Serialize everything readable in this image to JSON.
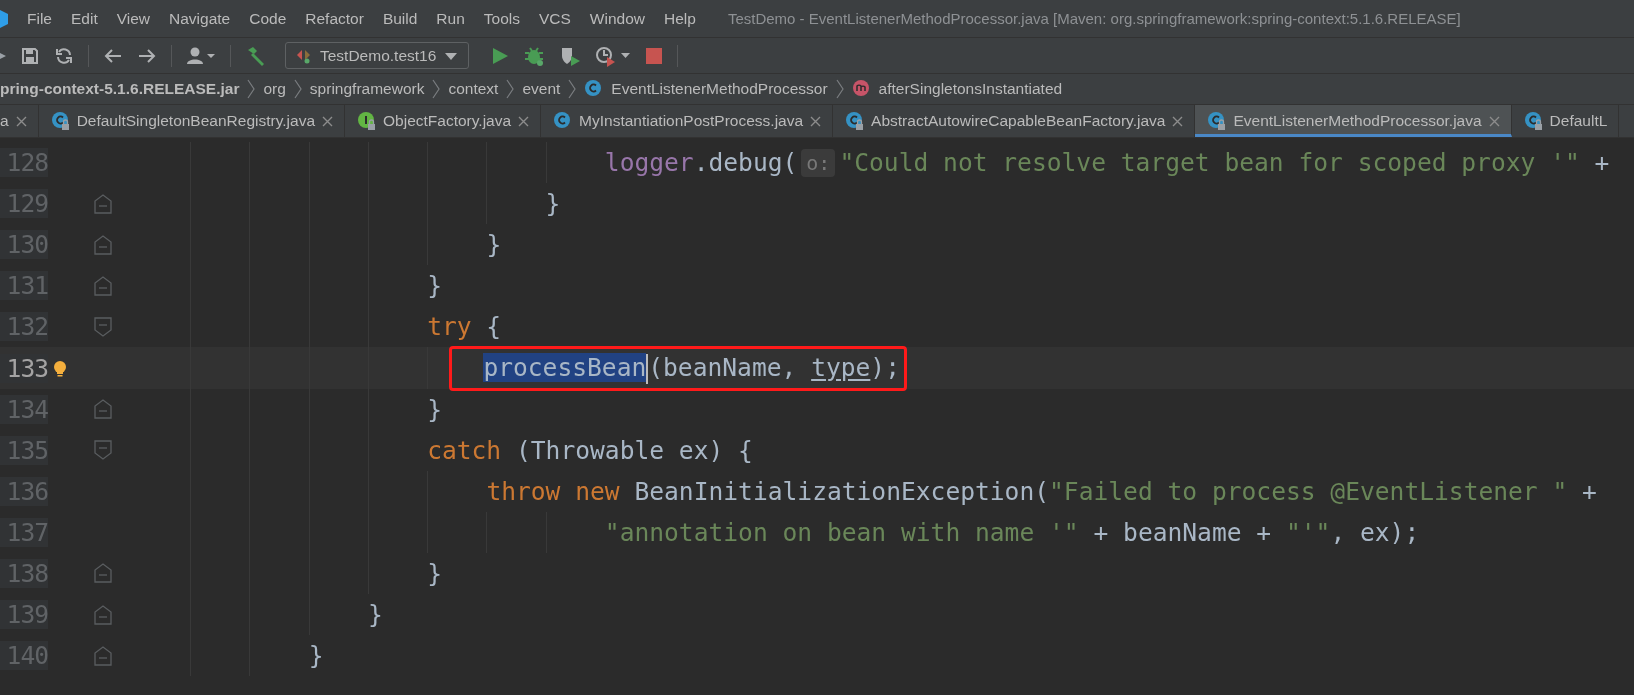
{
  "menu": [
    {
      "label": "File"
    },
    {
      "label": "Edit"
    },
    {
      "label": "View"
    },
    {
      "label": "Navigate"
    },
    {
      "label": "Code"
    },
    {
      "label": "Refactor"
    },
    {
      "label": "Build"
    },
    {
      "label": "Run"
    },
    {
      "label": "Tools"
    },
    {
      "label": "VCS"
    },
    {
      "label": "Window"
    },
    {
      "label": "Help"
    }
  ],
  "window": {
    "title": "TestDemo - EventListenerMethodProcessor.java [Maven: org.springframework:spring-context:5.1.6.RELEASE]"
  },
  "toolbar": {
    "run_configuration": "TestDemo.test16"
  },
  "breadcrumbs": [
    {
      "label": "pring-context-5.1.6.RELEASE.jar",
      "kind": "jar"
    },
    {
      "label": "org",
      "kind": "package"
    },
    {
      "label": "springframework",
      "kind": "package"
    },
    {
      "label": "context",
      "kind": "package"
    },
    {
      "label": "event",
      "kind": "package"
    },
    {
      "label": "EventListenerMethodProcessor",
      "kind": "class"
    },
    {
      "label": "afterSingletonsInstantiated",
      "kind": "method"
    }
  ],
  "tabs": [
    {
      "label": "a",
      "locked": false,
      "closable": true,
      "selected": false
    },
    {
      "label": "DefaultSingletonBeanRegistry.java",
      "kind": "class",
      "locked": true,
      "closable": true,
      "selected": false
    },
    {
      "label": "ObjectFactory.java",
      "kind": "interface",
      "locked": true,
      "closable": true,
      "selected": false
    },
    {
      "label": "MyInstantiationPostProcess.java",
      "kind": "class",
      "locked": false,
      "closable": true,
      "selected": false
    },
    {
      "label": "AbstractAutowireCapableBeanFactory.java",
      "kind": "class",
      "locked": true,
      "closable": true,
      "selected": false
    },
    {
      "label": "EventListenerMethodProcessor.java",
      "kind": "class",
      "locked": true,
      "closable": true,
      "selected": true
    },
    {
      "label": "DefaultL",
      "kind": "class",
      "locked": true,
      "closable": false,
      "selected": false
    }
  ],
  "editor": {
    "lines": [
      {
        "number": "128",
        "current": false,
        "bulb": false,
        "framed": false,
        "segments": [
          {
            "kind": "field",
            "text": "                                logger"
          },
          {
            "kind": "plain",
            "text": ".debug("
          },
          {
            "kind": "hint",
            "text": "o:"
          },
          {
            "kind": "string",
            "text": "\"Could not resolve target bean for scoped proxy '\""
          },
          {
            "kind": "plain",
            "text": " +"
          }
        ]
      },
      {
        "number": "129",
        "kind": "fold-end",
        "current": false,
        "bulb": false,
        "framed": false,
        "segments": [
          {
            "kind": "plain",
            "text": "                            }"
          }
        ]
      },
      {
        "number": "130",
        "kind": "fold-end",
        "current": false,
        "bulb": false,
        "framed": false,
        "segments": [
          {
            "kind": "plain",
            "text": "                        }"
          }
        ]
      },
      {
        "number": "131",
        "kind": "fold-end",
        "current": false,
        "bulb": false,
        "framed": false,
        "segments": [
          {
            "kind": "plain",
            "text": "                    }"
          }
        ]
      },
      {
        "number": "132",
        "kind": "fold-start",
        "current": false,
        "bulb": false,
        "framed": false,
        "segments": [
          {
            "kind": "keyword",
            "text": "                    try"
          },
          {
            "kind": "plain",
            "text": " {"
          }
        ]
      },
      {
        "number": "133",
        "current": true,
        "bulb": true,
        "framed": true,
        "segments": [
          {
            "kind": "selected",
            "text": "                        processBean"
          },
          {
            "kind": "plain",
            "text": "(beanName, "
          },
          {
            "kind": "underlined",
            "text": "type"
          },
          {
            "kind": "plain",
            "text": ");"
          }
        ]
      },
      {
        "number": "134",
        "kind": "fold-end",
        "current": false,
        "bulb": false,
        "framed": false,
        "segments": [
          {
            "kind": "plain",
            "text": "                    }"
          }
        ]
      },
      {
        "number": "135",
        "kind": "fold-start",
        "current": false,
        "bulb": false,
        "framed": false,
        "segments": [
          {
            "kind": "keyword",
            "text": "                    catch"
          },
          {
            "kind": "plain",
            "text": " (Throwable ex) {"
          }
        ]
      },
      {
        "number": "136",
        "current": false,
        "bulb": false,
        "framed": false,
        "segments": [
          {
            "kind": "keyword",
            "text": "                        throw new"
          },
          {
            "kind": "plain",
            "text": " BeanInitializationException("
          },
          {
            "kind": "string",
            "text": "\"Failed to process @EventListener \""
          },
          {
            "kind": "plain",
            "text": " +"
          }
        ]
      },
      {
        "number": "137",
        "current": false,
        "bulb": false,
        "framed": false,
        "segments": [
          {
            "kind": "string",
            "text": "                                \"annotation on bean with name '\""
          },
          {
            "kind": "plain",
            "text": " + beanName + "
          },
          {
            "kind": "string",
            "text": "\"'\""
          },
          {
            "kind": "plain",
            "text": ", ex);"
          }
        ]
      },
      {
        "number": "138",
        "kind": "fold-end",
        "current": false,
        "bulb": false,
        "framed": false,
        "segments": [
          {
            "kind": "plain",
            "text": "                    }"
          }
        ]
      },
      {
        "number": "139",
        "kind": "fold-end",
        "current": false,
        "bulb": false,
        "framed": false,
        "segments": [
          {
            "kind": "plain",
            "text": "                }"
          }
        ]
      },
      {
        "number": "140",
        "kind": "fold-end",
        "current": false,
        "bulb": false,
        "framed": false,
        "segments": [
          {
            "kind": "plain",
            "text": "            }"
          }
        ]
      }
    ]
  }
}
